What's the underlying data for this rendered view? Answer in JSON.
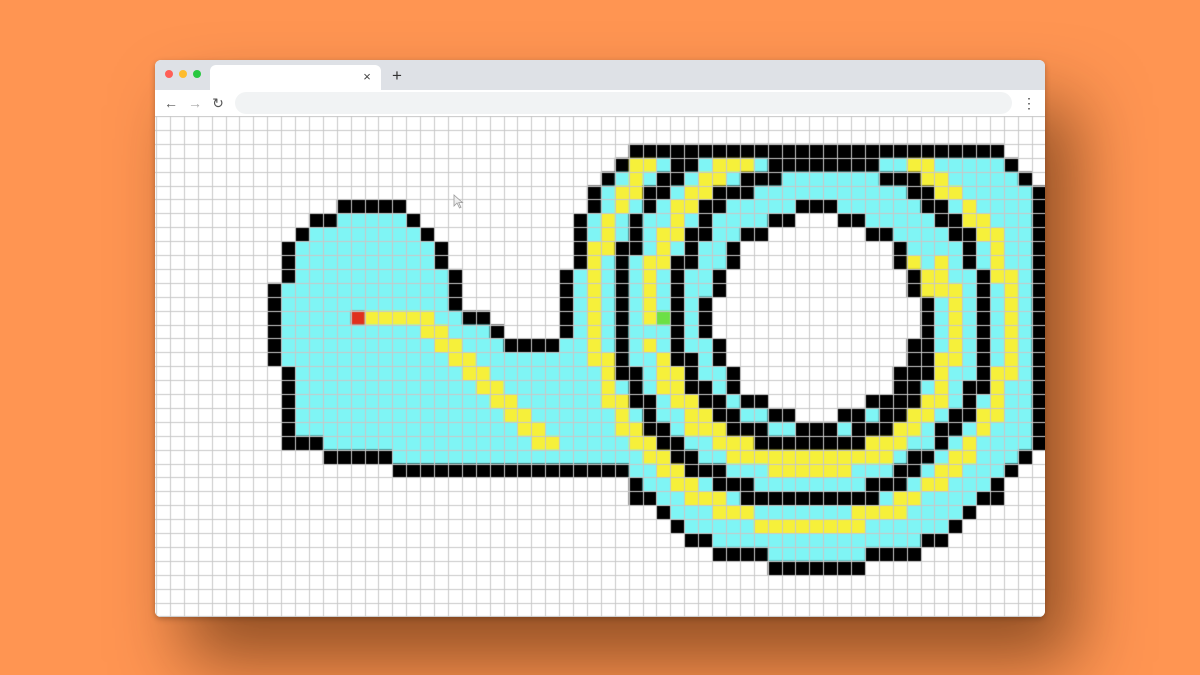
{
  "browser": {
    "tab_title": "",
    "tab_close_glyph": "×",
    "new_tab_glyph": "+",
    "address": "",
    "back_glyph": "←",
    "forward_glyph": "→",
    "reload_glyph": "↻",
    "menu_glyph": "⋮",
    "traffic_lights": [
      "#ff5f57",
      "#febc2e",
      "#28c840"
    ]
  },
  "pixel_art": {
    "subject": "snail",
    "grid": "on",
    "colors": {
      "outline": "#000000",
      "shell": "#7ff5f5",
      "stripe": "#f6f03a",
      "start_marker": "#e0301e",
      "end_marker": "#6ce045",
      "grid_line": "#c8c8c8"
    }
  },
  "icons": [
    "back-arrow-icon",
    "forward-arrow-icon",
    "reload-icon",
    "menu-dots-icon",
    "close-icon",
    "plus-icon",
    "mouse-pointer-icon"
  ]
}
